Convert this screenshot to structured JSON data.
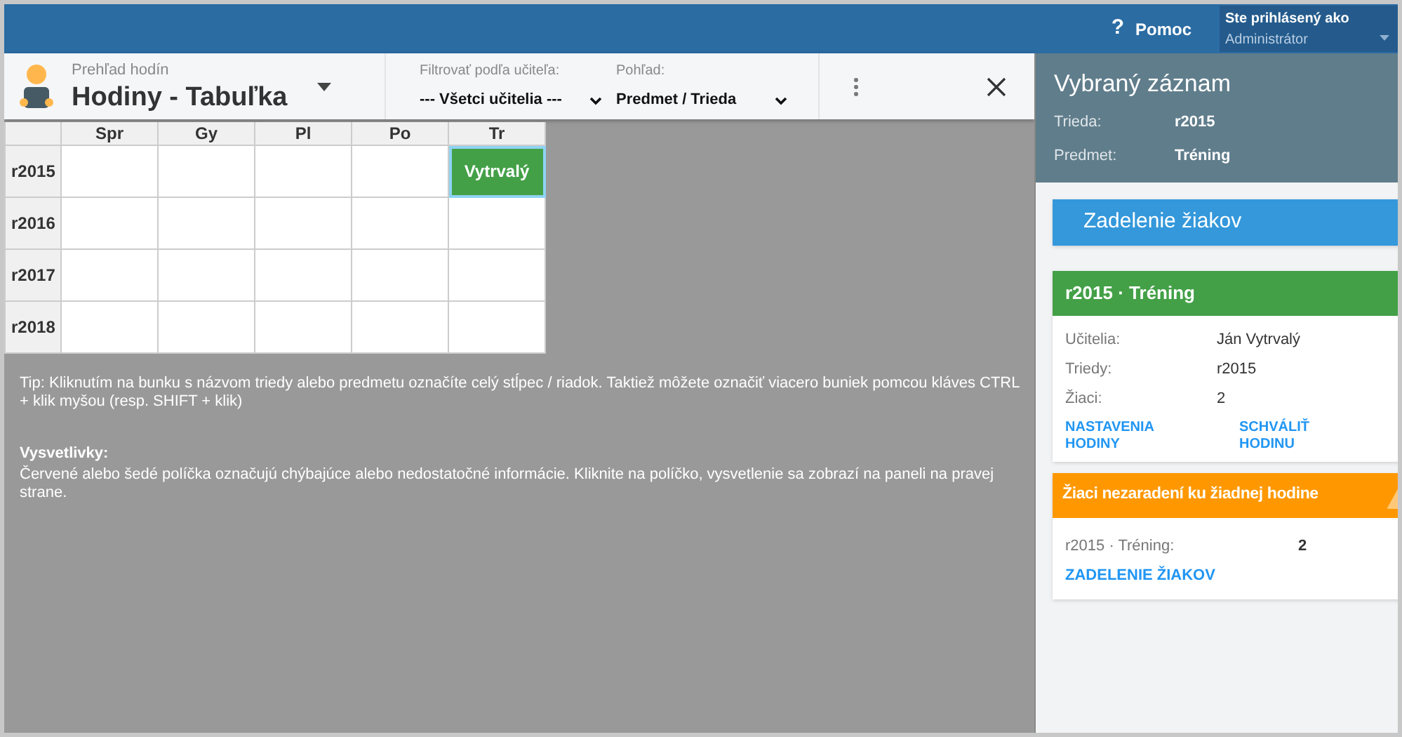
{
  "top_bar": {
    "help": {
      "icon_text": "?",
      "label": "Pomoc"
    },
    "user": {
      "caption": "Ste prihlásený ako",
      "name": "Administrátor"
    }
  },
  "toolbar": {
    "subtitle": "Prehľad hodín",
    "title": "Hodiny - Tabuľka",
    "filter": {
      "label": "Filtrovať podľa učiteľa:",
      "value": "--- Všetci učitelia ---"
    },
    "view": {
      "label": "Pohľad:",
      "value": "Predmet / Trieda"
    }
  },
  "table": {
    "columns": [
      "Spr",
      "Gy",
      "Pl",
      "Po",
      "Tr"
    ],
    "rows": [
      {
        "label": "r2015",
        "cells": [
          {
            "kind": "empty"
          },
          {
            "kind": "empty"
          },
          {
            "kind": "empty"
          },
          {
            "kind": "empty"
          },
          {
            "kind": "lesson",
            "text": "Vytrvalý",
            "selected": true
          }
        ]
      },
      {
        "label": "r2016",
        "cells": [
          {
            "kind": "empty"
          },
          {
            "kind": "empty"
          },
          {
            "kind": "empty"
          },
          {
            "kind": "empty"
          },
          {
            "kind": "empty"
          }
        ]
      },
      {
        "label": "r2017",
        "cells": [
          {
            "kind": "empty"
          },
          {
            "kind": "empty"
          },
          {
            "kind": "empty"
          },
          {
            "kind": "empty"
          },
          {
            "kind": "empty"
          }
        ]
      },
      {
        "label": "r2018",
        "cells": [
          {
            "kind": "empty"
          },
          {
            "kind": "empty"
          },
          {
            "kind": "empty"
          },
          {
            "kind": "empty"
          },
          {
            "kind": "empty"
          }
        ]
      }
    ]
  },
  "tip": "Tip: Kliknutím na bunku s názvom triedy alebo predmetu označíte celý stĺpec / riadok. Taktiež môžete označiť viacero buniek pomcou kláves CTRL + klik myšou (resp. SHIFT + klik)",
  "legend": {
    "title": "Vysvetlivky:",
    "text": "Červené alebo šedé políčka označujú chýbajúce alebo nedostatočné informácie. Kliknite na políčko, vysvetlenie sa zobrazí na paneli na pravej strane."
  },
  "side_panel": {
    "title": "Vybraný záznam",
    "fields": [
      {
        "label": "Trieda:",
        "value": "r2015"
      },
      {
        "label": "Predmet:",
        "value": "Tréning"
      }
    ],
    "assign_button": "Zadelenie žiakov",
    "lesson_card": {
      "title": "r2015 · Tréning",
      "fields": [
        {
          "label": "Učitelia:",
          "value": "Ján Vytrvalý"
        },
        {
          "label": "Triedy:",
          "value": "r2015"
        },
        {
          "label": "Žiaci:",
          "value": "2"
        }
      ],
      "actions": [
        "NASTAVENIA HODINY",
        "SCHVÁLIŤ HODINU"
      ]
    },
    "warning_card": {
      "title": "Žiaci nezaradení ku žiadnej hodine",
      "rows": [
        {
          "label": "r2015 · Tréning:",
          "value": "2"
        }
      ],
      "action": "ZADELENIE ŽIAKOV"
    }
  }
}
